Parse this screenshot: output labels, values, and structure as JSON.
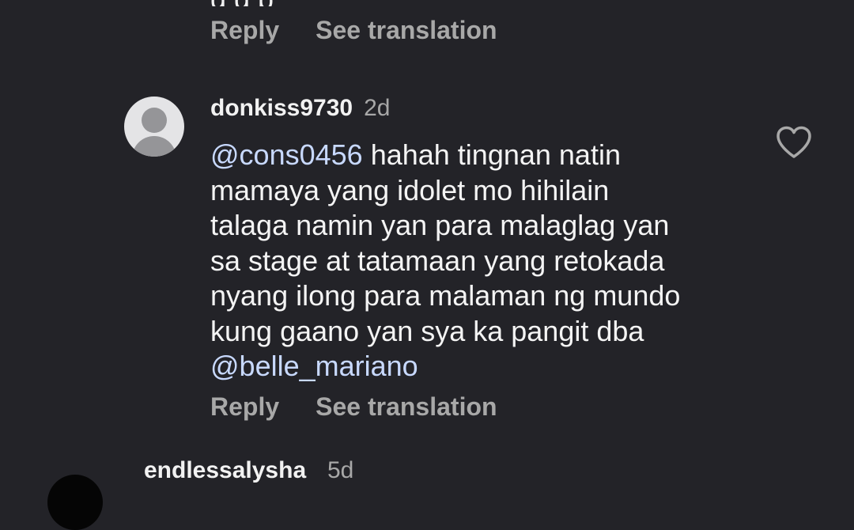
{
  "previous_comment": {
    "partial_text_bottom": "g     g     p",
    "reply_label": "Reply",
    "see_translation_label": "See translation"
  },
  "comment": {
    "username": "donkiss9730",
    "time_ago": "2d",
    "line1_mention": "@cons0456",
    "line1_rest": " hahah tingnan natin",
    "line2": "mamaya yang idolet mo hihilain",
    "line3": "talaga namin yan para malaglag yan",
    "line4": "sa stage at tatamaan yang retokada",
    "line5": "nyang ilong para malaman ng mundo",
    "line6": "kung gaano yan sya ka pangit dba",
    "line7_mention": "@belle_mariano",
    "reply_label": "Reply",
    "see_translation_label": "See translation",
    "like_icon": "heart-outline-icon"
  },
  "next_comment": {
    "username_partial": "endlessalysha",
    "time_ago_partial": "5d"
  }
}
